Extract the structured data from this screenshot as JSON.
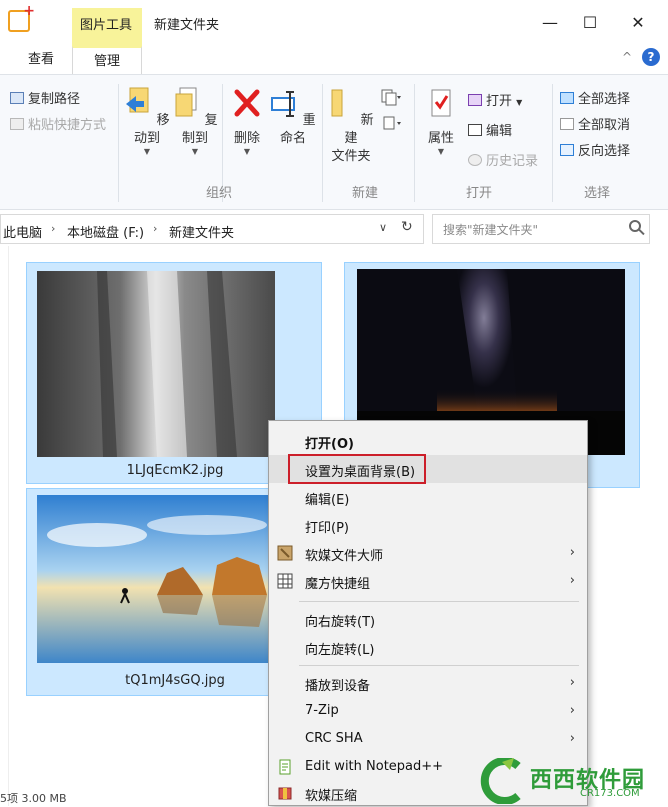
{
  "window": {
    "context_tab": "图片工具",
    "title": "新建文件夹",
    "minimize": "—",
    "maximize": "☐",
    "close": "✕"
  },
  "tabs": {
    "view": "查看",
    "manage": "管理",
    "collapse": "^",
    "help": "?"
  },
  "ribbon": {
    "copy_path": "复制路径",
    "paste_shortcut": "粘贴快捷方式",
    "move_to": "移动到",
    "copy_to": "复制到",
    "delete": "删除",
    "rename": "重命名",
    "new_folder_line1": "新建",
    "new_folder_line2": "文件夹",
    "properties": "属性",
    "open": "打开",
    "edit": "编辑",
    "history": "历史记录",
    "select_all": "全部选择",
    "select_none": "全部取消",
    "invert_selection": "反向选择",
    "group_organize": "组织",
    "group_new": "新建",
    "group_open": "打开",
    "group_select": "选择"
  },
  "address": {
    "crumbs": [
      "此电脑",
      "本地磁盘 (F:)",
      "新建文件夹"
    ],
    "sep": "›",
    "dropdown": "∨",
    "refresh": "↻"
  },
  "search": {
    "placeholder": "搜索\"新建文件夹\""
  },
  "files": [
    {
      "name": "1LJqEcmK2.jpg"
    },
    {
      "name": ""
    },
    {
      "name": "tQ1mJ4sGQ.jpg"
    }
  ],
  "status": {
    "text": "5项  3.00 MB"
  },
  "context_menu": {
    "items": [
      {
        "label": "打开(O)",
        "arrow": ""
      },
      {
        "label": "设置为桌面背景(B)",
        "arrow": ""
      },
      {
        "label": "编辑(E)",
        "arrow": ""
      },
      {
        "label": "打印(P)",
        "arrow": ""
      },
      {
        "label": "软媒文件大师",
        "arrow": "›"
      },
      {
        "label": "魔方快捷组",
        "arrow": "›"
      },
      {
        "label": "向右旋转(T)",
        "arrow": ""
      },
      {
        "label": "向左旋转(L)",
        "arrow": ""
      },
      {
        "label": "播放到设备",
        "arrow": "›"
      },
      {
        "label": "7-Zip",
        "arrow": "›"
      },
      {
        "label": "CRC SHA",
        "arrow": "›"
      },
      {
        "label": "Edit with Notepad++",
        "arrow": ""
      },
      {
        "label": "软媒压缩",
        "arrow": ""
      }
    ]
  },
  "watermark": {
    "brand": "西西软件园",
    "url": "CR173.COM"
  },
  "colors": {
    "selection_fill": "#cce8ff",
    "selection_border": "#99d1ff",
    "highlight_box": "#cc1f2a",
    "context_tab": "#f8f39a"
  }
}
